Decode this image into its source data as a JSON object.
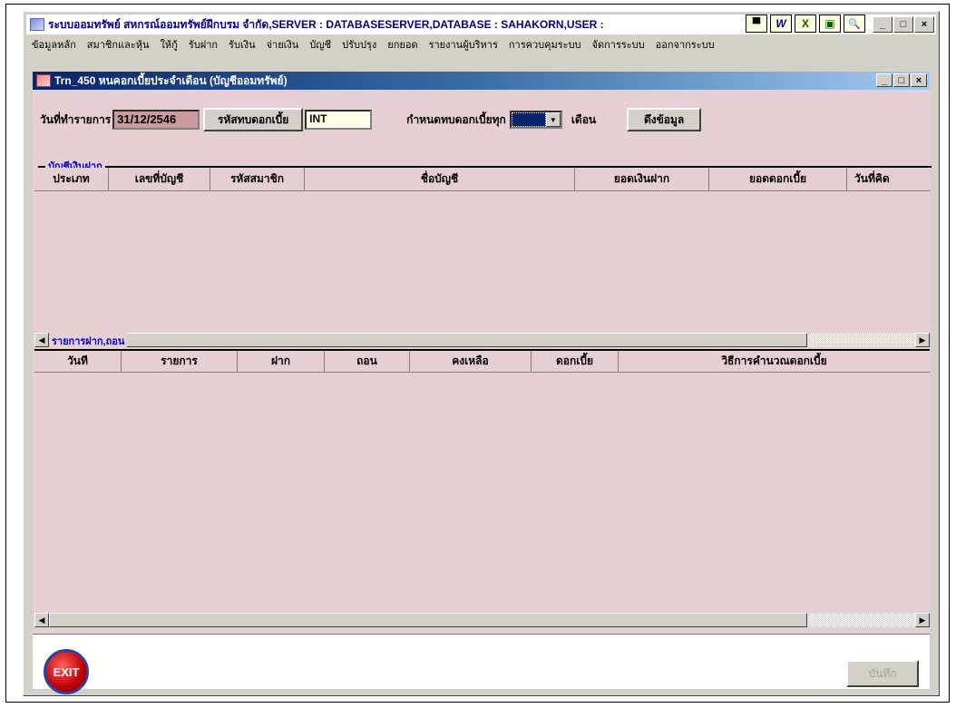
{
  "app": {
    "title": "ระบบออมทรัพย์ สหกรณ์ออมทรัพย์ฝึกบรม จำกัด,SERVER : DATABASESERVER,DATABASE : SAHAKORN,USER :",
    "toolbar_icons": [
      "▀",
      "W",
      "X",
      "▣",
      "🔍"
    ],
    "window_buttons": [
      "_",
      "□",
      "×"
    ]
  },
  "menu": [
    "ข้อมูลหลัก",
    "สมาชิกและหุ้น",
    "ให้กู้",
    "รับฝาก",
    "รับเงิน",
    "จ่ายเงิน",
    "บัญชี",
    "ปรับปรุง",
    "ยกยอด",
    "รายงานผู้บริหาร",
    "การควบคุมระบบ",
    "จัดการระบบ",
    "ออกจากระบบ"
  ],
  "child": {
    "title": "Trn_450 หนคอกเบี้ยประจำเดือน (บัญชีออมทรัพย์)",
    "window_buttons": [
      "_",
      "□",
      "×"
    ]
  },
  "form": {
    "date_label": "วันที่ทำรายการ",
    "date_value": "31/12/2546",
    "interest_code_button": "รหัสทบดอกเบี้ย",
    "interest_code_value": "INT",
    "every_label": "กำหนดทบดอกเบี้ยทุก",
    "month_label": "เดือน",
    "fetch_button": "ดึงข้อมูล"
  },
  "deposit_grid": {
    "caption": "บัญชีเงินฝาก",
    "columns": [
      "ประเภท",
      "เลขที่บัญชี",
      "รหัสสมาชิก",
      "ชื่อบัญชี",
      "ยอดเงินฝาก",
      "ยอดดอกเบี้ย",
      "วันที่คิด"
    ]
  },
  "tx_grid": {
    "caption": "รายการฝาก,ถอน",
    "columns": [
      "วันที",
      "รายการ",
      "ฝาก",
      "ถอน",
      "คงเหลือ",
      "ดอกเบี้ย",
      "วิธีการคำนวณดอกเบี้ย"
    ]
  },
  "footer": {
    "exit_label": "EXIT",
    "save_label": "บันทึก"
  }
}
